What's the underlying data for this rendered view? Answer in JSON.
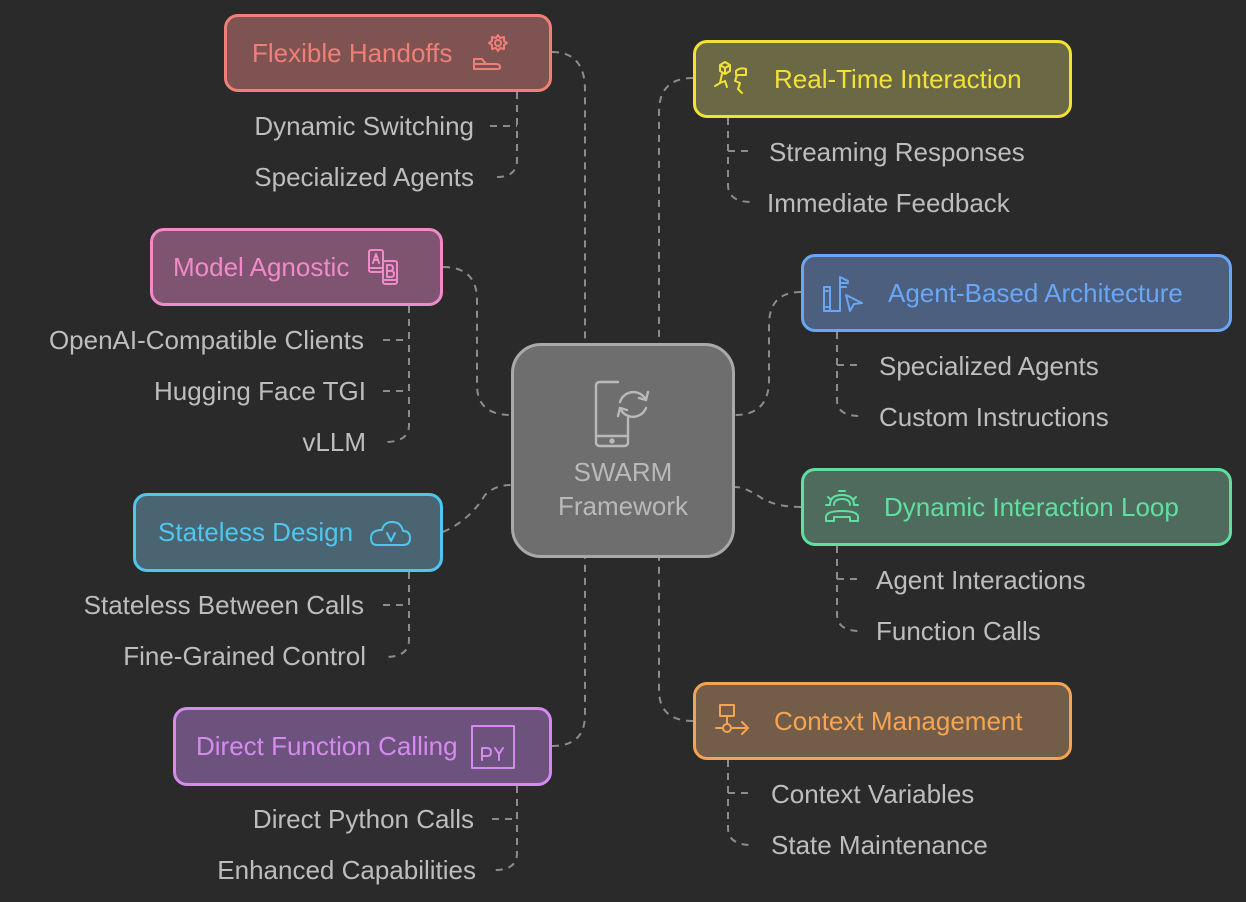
{
  "center": {
    "line1": "SWARM",
    "line2": "Framework",
    "icon": "phone-sync-icon"
  },
  "branches": {
    "flexible_handoffs": {
      "label": "Flexible Handoffs",
      "icon": "gear-hand-icon",
      "color": "#f07f78",
      "fill": "#7f5352",
      "children": [
        "Dynamic Switching",
        "Specialized Agents"
      ]
    },
    "model_agnostic": {
      "label": "Model Agnostic",
      "icon": "ab-devices-icon",
      "color": "#f08ac8",
      "fill": "#7f5470",
      "children": [
        "OpenAI-Compatible Clients",
        "Hugging Face TGI",
        "vLLM"
      ]
    },
    "stateless_design": {
      "label": "Stateless Design",
      "icon": "cloud-check-icon",
      "color": "#4fc6ee",
      "fill": "#4b6472",
      "children": [
        "Stateless Between Calls",
        "Fine-Grained Control"
      ]
    },
    "direct_function_calling": {
      "label": "Direct Function Calling",
      "icon": "python-file-icon",
      "color": "#d68af0",
      "fill": "#6e527e",
      "children": [
        "Direct Python Calls",
        "Enhanced Capabilities"
      ]
    },
    "real_time_interaction": {
      "label": "Real-Time Interaction",
      "icon": "interaction-icon",
      "color": "#f2e236",
      "fill": "#6b6846",
      "children": [
        "Streaming Responses",
        "Immediate Feedback"
      ]
    },
    "agent_based_architecture": {
      "label": "Agent-Based Architecture",
      "icon": "building-cursor-icon",
      "color": "#69a6f5",
      "fill": "#4d5f7f",
      "children": [
        "Specialized Agents",
        "Custom Instructions"
      ]
    },
    "dynamic_interaction_loop": {
      "label": "Dynamic Interaction Loop",
      "icon": "gear-phone-icon",
      "color": "#5fe0a0",
      "fill": "#4f6b5e",
      "children": [
        "Agent Interactions",
        "Function Calls"
      ]
    },
    "context_management": {
      "label": "Context Management",
      "icon": "flow-arrow-icon",
      "color": "#f5a552",
      "fill": "#735d49",
      "children": [
        "Context Variables",
        "State Maintenance"
      ]
    }
  }
}
